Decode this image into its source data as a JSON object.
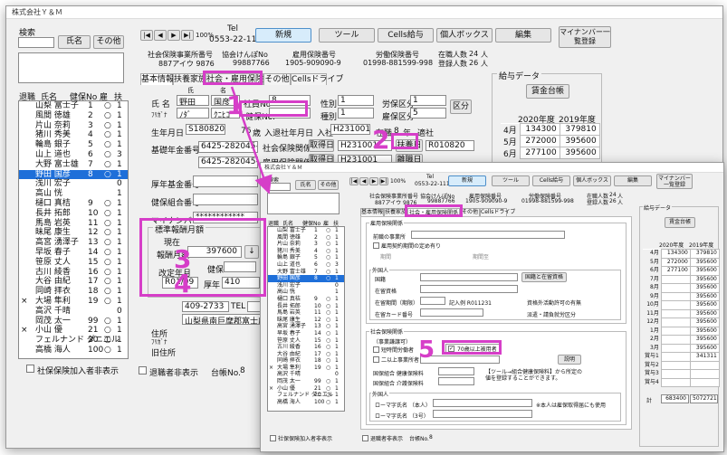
{
  "company": "株式会社Ｙ＆Ｍ",
  "toolbar": {
    "nav_first": "|◀",
    "nav_prev": "◀",
    "nav_next": "▶",
    "nav_last": "▶|",
    "zoom": "100%",
    "tel_label": "Tel",
    "tel": "0553-22-1118",
    "new": "新規",
    "tools": "ツール",
    "cells_payroll": "Cells給与",
    "personal_box": "個人ボックス",
    "edit": "編集",
    "mynumber": "マイナンバー一覧登録"
  },
  "info": {
    "soc_label": "社会保険事業所番号",
    "soc_no": "887アイウ 9876",
    "assoc_label": "協会けんぽNo",
    "assoc_no": "99887766",
    "emp_label": "雇用保険番号",
    "emp_no": "1905-909090-9",
    "labor_label": "労働保険番号",
    "labor_no": "01998-881599-998",
    "enrolled_label": "在職人数",
    "enrolled": "24",
    "enrolled_unit": "人",
    "registered_label": "登録人数",
    "registered": "26",
    "registered_unit": "人"
  },
  "search": {
    "label": "検索",
    "name_btn": "氏名",
    "other_btn": "その他"
  },
  "list": {
    "headers": [
      "退職",
      "氏名",
      "健保No",
      "雇",
      "扶"
    ],
    "rows": [
      [
        "",
        "山梨 富士子",
        "1",
        "○",
        "1"
      ],
      [
        "",
        "風間 徳雄",
        "2",
        "○",
        "1"
      ],
      [
        "",
        "片山 奈莉",
        "3",
        "○",
        "1"
      ],
      [
        "",
        "猪川 秀美",
        "4",
        "○",
        "1"
      ],
      [
        "",
        "輪島 銀子",
        "5",
        "○",
        "1"
      ],
      [
        "",
        "山上 道也",
        "6",
        "○",
        "3"
      ],
      [
        "",
        "大野 富士雄",
        "7",
        "○",
        "1"
      ],
      [
        "",
        "野田 国彦",
        "8",
        "○",
        "1"
      ],
      [
        "",
        "浅川 宏子",
        "",
        "",
        "0"
      ],
      [
        "",
        "高山 恍",
        "",
        "",
        "1"
      ],
      [
        "",
        "樋口 真桔",
        "9",
        "○",
        "1"
      ],
      [
        "",
        "長井 拓郎",
        "10",
        "○",
        "1"
      ],
      [
        "",
        "馬島 岩英",
        "11",
        "○",
        "1"
      ],
      [
        "",
        "昧尾 康生",
        "12",
        "○",
        "1"
      ],
      [
        "",
        "高宮 湧澤子",
        "13",
        "○",
        "1"
      ],
      [
        "",
        "早坂 春子",
        "14",
        "○",
        "1"
      ],
      [
        "",
        "笹原 丈人",
        "15",
        "○",
        "1"
      ],
      [
        "",
        "古川 綾香",
        "16",
        "○",
        "1"
      ],
      [
        "",
        "大谷 由紀",
        "17",
        "○",
        "1"
      ],
      [
        "",
        "同崎 拝衣",
        "18",
        "○",
        "1"
      ],
      [
        "×",
        "大場 隼利",
        "19",
        "○",
        "1"
      ],
      [
        "",
        "高沢 千晴",
        "",
        "",
        "0"
      ],
      [
        "",
        "岡茂 太一",
        "99",
        "○",
        "1"
      ],
      [
        "×",
        "小山 優",
        "21",
        "○",
        "1"
      ],
      [
        "",
        "フェルナンド ダニエル",
        "20",
        "○",
        "1"
      ],
      [
        "",
        "高橋 海人",
        "100",
        "○",
        "1"
      ]
    ]
  },
  "tabs": {
    "basic": "基本情報",
    "dependents": "扶養家族",
    "social": "社会・雇用保険関係",
    "other": "その他",
    "cells_drive": "Cellsドライブ"
  },
  "basic": {
    "name_label": "氏 名",
    "kana_label": "ﾌﾘｶﾞﾅ",
    "family_hdr": "氏",
    "given_hdr": "名",
    "family": "野田",
    "given": "国彦",
    "kana_family": "ﾉﾀﾞ",
    "kana_given": "ｸﾆﾋｺ",
    "emp_no_label": "社員No",
    "emp_no": "8",
    "kenpo_label": "健保No.",
    "gender_label": "性別",
    "gender": "1",
    "labor_cat_label": "労保区分",
    "labor_cat": "1",
    "kind_label": "種別",
    "kind": "1",
    "emp_cat_label": "雇保区分",
    "emp_cat": "5",
    "cat_btn": "区分",
    "birth_label": "生年月日",
    "birth": "S180820",
    "age": "76",
    "age_unit": "歳",
    "join_label": "入退社年月日",
    "join_in": "入社",
    "join_date": "H231001",
    "tenure_label": "在職",
    "tenure": "8",
    "tenure_unit": "年",
    "apply_label": "適社",
    "pension_label": "基礎年金番号",
    "pension": "6425-282045-1",
    "ins_rel_label": "社会保険関係",
    "acquire_btn": "取得日",
    "acquire_date": "H231001",
    "grade_change_btn": "扶養日",
    "grade_change_date": "R010820",
    "emp_rel_label": "雇用保険関係",
    "emp_acquire_btn": "取得日",
    "emp_acquire_date": "H231001",
    "leave_btn": "離職日",
    "pension_book_label": "厚年基金番号",
    "kenpo_cert_label": "健保組合番号",
    "mynumber_label": "マイナンバー",
    "mynumber": "************",
    "std_label": "標準報酬月額",
    "current": "現在",
    "std_monthly_label": "報酬月額",
    "std_monthly": "397600",
    "arrow_btn": "↓",
    "revise_label": "改定年月",
    "revise": "R01/09",
    "kenpo_label2": "健保",
    "kenpo_val": "",
    "pension_label2": "厚年",
    "pension_val": "410",
    "tel_label": "TEL",
    "tel": "409-2733",
    "addr_label": "住所",
    "addr": "山梨県南巨摩郡富士川町赤沢1-1",
    "kana_addr_label": "ﾌﾘｶﾞﾅ",
    "former_label": "旧住所"
  },
  "payroll": {
    "label": "給与データ",
    "ledger_btn": "賃金台帳",
    "col_2020": "2020年度",
    "col_2019": "2019年度",
    "rows_back": [
      [
        "4月",
        "134300",
        "379810"
      ],
      [
        "5月",
        "272000",
        "395600"
      ],
      [
        "6月",
        "277100",
        "395600"
      ]
    ],
    "rows_front": [
      [
        "4月",
        "134300",
        "379810"
      ],
      [
        "5月",
        "272000",
        "395600"
      ],
      [
        "6月",
        "277100",
        "395600"
      ],
      [
        "7月",
        "",
        "395600"
      ],
      [
        "8月",
        "",
        "395600"
      ],
      [
        "9月",
        "",
        "395600"
      ],
      [
        "10月",
        "",
        "395600"
      ],
      [
        "11月",
        "",
        "395600"
      ],
      [
        "12月",
        "",
        "395600"
      ],
      [
        "1月",
        "",
        "395600"
      ],
      [
        "2月",
        "",
        "395600"
      ],
      [
        "3月",
        "",
        "395600"
      ],
      [
        "賞与1",
        "",
        "341311"
      ],
      [
        "賞与2",
        "",
        ""
      ],
      [
        "賞与3",
        "",
        ""
      ],
      [
        "賞与4",
        "",
        ""
      ]
    ],
    "total_label": "計",
    "total_2020": "683400",
    "total_2019": "5072721"
  },
  "social": {
    "emp_ins_label": "雇用保険関係",
    "prev_office": "前職の事業所",
    "contract_chk": "雇用契約期間の定め有り",
    "period": "期間",
    "period_to": "期間至",
    "foreigner_label": "外国人",
    "nationality": "国籍",
    "nationality_btn": "国籍と在留資格",
    "residence": "在留資格",
    "period_label": "在留期間（期限）",
    "record": "記入例 R011231",
    "work_perm": "資格外活動許可の有無",
    "card_no": "在留カード番号",
    "dispatch": "派遣・請負就労区分",
    "soc_ins_label": "社会保険関係",
    "type_label": "（事業謙譲可）",
    "short_time": "短時間労働者",
    "over70_chk": "70歳以上被用者",
    "two_plus": "二以上事業所者",
    "explain_btn": "説明",
    "kumiai_kenpo": "国保組合 健康保険料",
    "kumiai_kaigo": "国保組合 介護保険料",
    "kumiai_note": "【ツール→組合健康保険料】から所定の値を登録することができます。",
    "foreigner2_label": "外国人",
    "roman_name": "ローマ字氏名 （本人）",
    "roman_name2": "ローマ字氏名 （3号）",
    "roman_note": "※本人は雇保取得届にも使用"
  },
  "footer": {
    "social_chk": "社保保険加入者非表示",
    "retired_chk": "退職者非表示",
    "ledger_label": "台帳No.",
    "ledger_no": "8"
  },
  "callouts": [
    "1",
    "2",
    "3",
    "4",
    "5"
  ],
  "colors": {
    "accent": "#d63ec8",
    "selection": "#1e6fd9",
    "new_btn": "#d7ecfb"
  }
}
